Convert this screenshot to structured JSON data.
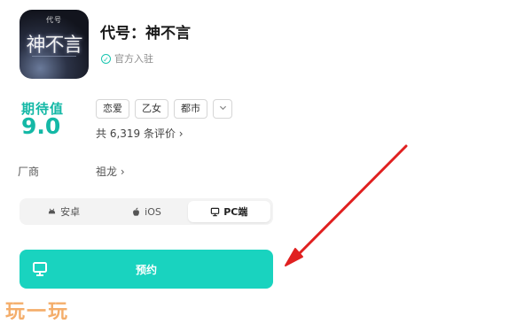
{
  "game": {
    "icon_top_text": "代号",
    "icon_title": "神不言",
    "title": "代号：神不言",
    "verified_text": "官方入驻"
  },
  "rating": {
    "label": "期待值",
    "value": "9.0",
    "tags": [
      "恋爱",
      "乙女",
      "都市"
    ],
    "more_icon": "chevron-down-icon",
    "reviews_text": "共 6,319 条评价 ›"
  },
  "vendor": {
    "label": "厂商",
    "value": "祖龙 ›"
  },
  "platforms": {
    "items": [
      {
        "label": "安卓",
        "icon": "android-icon"
      },
      {
        "label": "iOS",
        "icon": "apple-icon"
      },
      {
        "label": "PC端",
        "icon": "monitor-icon"
      }
    ],
    "selected": "PC端"
  },
  "reserve_button": {
    "label": "预约",
    "icon": "monitor-icon"
  },
  "watermark": "玩一玩",
  "colors": {
    "accent": "#19d3bf",
    "score": "#14b8a6",
    "arrow": "#e02020",
    "watermark": "#f3a55a"
  }
}
